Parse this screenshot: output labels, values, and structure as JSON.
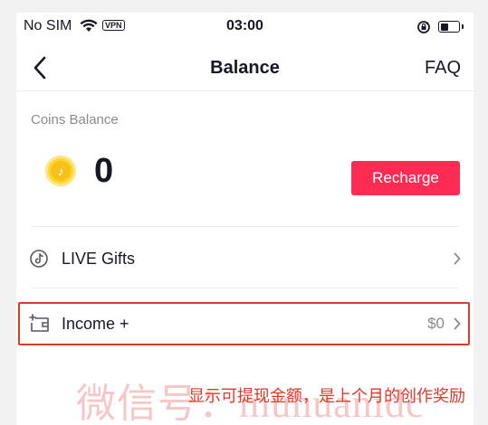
{
  "status_bar": {
    "carrier": "No SIM",
    "vpn": "VPN",
    "time": "03:00",
    "battery_level": 0.4
  },
  "nav": {
    "title": "Balance",
    "faq": "FAQ"
  },
  "coins": {
    "label": "Coins Balance",
    "amount": "0",
    "coin_glyph": "♪",
    "recharge": "Recharge"
  },
  "live_gifts": {
    "label": "LIVE Gifts"
  },
  "income": {
    "label": "Income +",
    "value": "$0"
  },
  "overlay": {
    "watermark": "微信号：muhuanidc",
    "caption": "显示可提现金额，是上个月的创作奖励"
  },
  "colors": {
    "accent": "#fe2c55",
    "highlight": "#e0392b",
    "coin": "#fbd62c"
  }
}
